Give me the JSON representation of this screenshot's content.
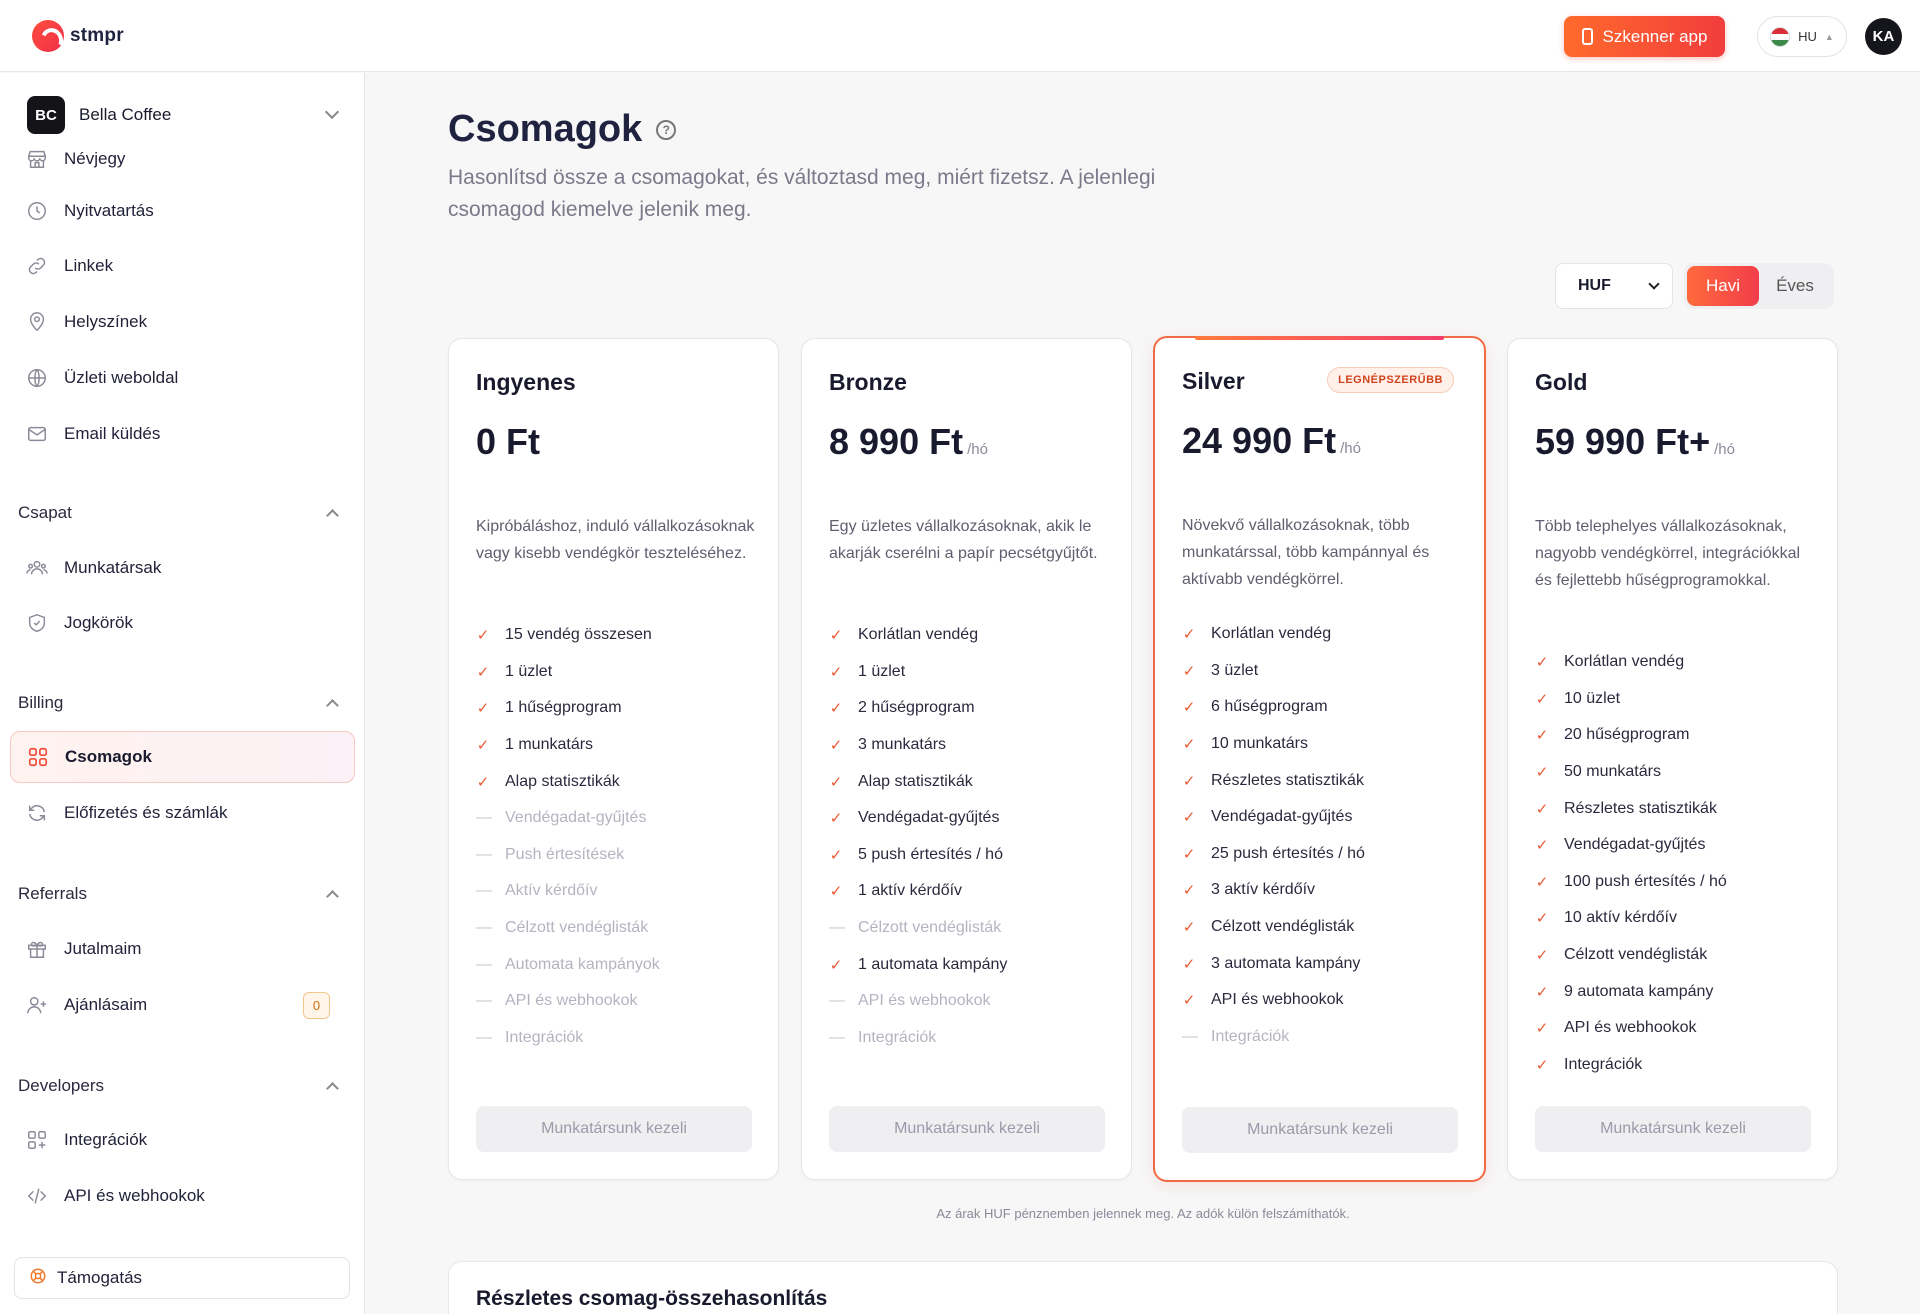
{
  "app": {
    "logo_text": "stmpr"
  },
  "topbar": {
    "scanner_label": "Szkenner app",
    "language": "HU",
    "user_initials": "KA"
  },
  "sidebar": {
    "business": {
      "initials": "BC",
      "name": "Bella Coffee"
    },
    "items_main": [
      {
        "label": "Névjegy",
        "icon": "store-icon"
      },
      {
        "label": "Nyitvatartás",
        "icon": "clock-icon"
      },
      {
        "label": "Linkek",
        "icon": "link-icon"
      },
      {
        "label": "Helyszínek",
        "icon": "location-pin-icon"
      },
      {
        "label": "Üzleti weboldal",
        "icon": "globe-icon"
      },
      {
        "label": "Email küldés",
        "icon": "mail-icon"
      }
    ],
    "sections": {
      "team": {
        "title": "Csapat",
        "items": [
          {
            "label": "Munkatársak",
            "icon": "users-icon"
          },
          {
            "label": "Jogkörök",
            "icon": "shield-icon"
          }
        ]
      },
      "billing": {
        "title": "Billing",
        "items": [
          {
            "label": "Csomagok",
            "icon": "grid-icon"
          },
          {
            "label": "Előfizetés és számlák",
            "icon": "refresh-icon"
          }
        ]
      },
      "referrals": {
        "title": "Referrals",
        "items": [
          {
            "label": "Jutalmaim",
            "icon": "gift-icon"
          },
          {
            "label": "Ajánlásaim",
            "icon": "user-plus-icon",
            "count": "0"
          }
        ]
      },
      "developers": {
        "title": "Developers",
        "items": [
          {
            "label": "Integrációk",
            "icon": "puzzle-icon"
          },
          {
            "label": "API és webhookok",
            "icon": "code-icon"
          }
        ]
      }
    },
    "support_label": "Támogatás"
  },
  "main": {
    "title": "Csomagok",
    "subtitle": "Hasonlítsd össze a csomagokat, és változtasd meg, miért fizetsz. A jelenlegi csomagod kiemelve jelenik meg.",
    "currency": "HUF",
    "period_options": [
      "Havi",
      "Éves"
    ],
    "period_selected": "Havi",
    "plans": [
      {
        "name": "Ingyenes",
        "price": "0 Ft",
        "per": "",
        "description": "Kipróbáláshoz, induló vállalkozásoknak vagy kisebb vendégkör teszteléséhez.",
        "features": [
          {
            "text": "15 vendég összesen",
            "included": true
          },
          {
            "text": "1 üzlet",
            "included": true
          },
          {
            "text": "1 hűségprogram",
            "included": true
          },
          {
            "text": "1 munkatárs",
            "included": true
          },
          {
            "text": "Alap statisztikák",
            "included": true
          },
          {
            "text": "Vendégadat-gyűjtés",
            "included": false
          },
          {
            "text": "Push értesítések",
            "included": false
          },
          {
            "text": "Aktív kérdőív",
            "included": false
          },
          {
            "text": "Célzott vendéglisták",
            "included": false
          },
          {
            "text": "Automata kampányok",
            "included": false
          },
          {
            "text": "API és webhookok",
            "included": false
          },
          {
            "text": "Integrációk",
            "included": false
          }
        ],
        "button": "Munkatársunk kezeli"
      },
      {
        "name": "Bronze",
        "price": "8 990 Ft",
        "per": "/hó",
        "description": "Egy üzletes vállalkozásoknak, akik le akarják cserélni a papír pecsétgyűjtőt.",
        "features": [
          {
            "text": "Korlátlan vendég",
            "included": true
          },
          {
            "text": "1 üzlet",
            "included": true
          },
          {
            "text": "2 hűségprogram",
            "included": true
          },
          {
            "text": "3 munkatárs",
            "included": true
          },
          {
            "text": "Alap statisztikák",
            "included": true
          },
          {
            "text": "Vendégadat-gyűjtés",
            "included": true
          },
          {
            "text": "5 push értesítés / hó",
            "included": true
          },
          {
            "text": "1 aktív kérdőív",
            "included": true
          },
          {
            "text": "Célzott vendéglisták",
            "included": false
          },
          {
            "text": "1 automata kampány",
            "included": true
          },
          {
            "text": "API és webhookok",
            "included": false
          },
          {
            "text": "Integrációk",
            "included": false
          }
        ],
        "button": "Munkatársunk kezeli"
      },
      {
        "name": "Silver",
        "price": "24 990 Ft",
        "per": "/hó",
        "badge": "LEGNÉPSZERŰBB",
        "description": "Növekvő vállalkozásoknak, több munkatárssal, több kampánnyal és aktívabb vendégkörrel.",
        "features": [
          {
            "text": "Korlátlan vendég",
            "included": true
          },
          {
            "text": "3 üzlet",
            "included": true
          },
          {
            "text": "6 hűségprogram",
            "included": true
          },
          {
            "text": "10 munkatárs",
            "included": true
          },
          {
            "text": "Részletes statisztikák",
            "included": true
          },
          {
            "text": "Vendégadat-gyűjtés",
            "included": true
          },
          {
            "text": "25 push értesítés / hó",
            "included": true
          },
          {
            "text": "3 aktív kérdőív",
            "included": true
          },
          {
            "text": "Célzott vendéglisták",
            "included": true
          },
          {
            "text": "3 automata kampány",
            "included": true
          },
          {
            "text": "API és webhookok",
            "included": true
          },
          {
            "text": "Integrációk",
            "included": false
          }
        ],
        "button": "Munkatársunk kezeli"
      },
      {
        "name": "Gold",
        "price": "59 990 Ft+",
        "per": "/hó",
        "description": "Több telephelyes vállalkozásoknak, nagyobb vendégkörrel, integrációkkal és fejlettebb hűségprogramokkal.",
        "features": [
          {
            "text": "Korlátlan vendég",
            "included": true
          },
          {
            "text": "10 üzlet",
            "included": true
          },
          {
            "text": "20 hűségprogram",
            "included": true
          },
          {
            "text": "50 munkatárs",
            "included": true
          },
          {
            "text": "Részletes statisztikák",
            "included": true
          },
          {
            "text": "Vendégadat-gyűjtés",
            "included": true
          },
          {
            "text": "100 push értesítés / hó",
            "included": true
          },
          {
            "text": "10 aktív kérdőív",
            "included": true
          },
          {
            "text": "Célzott vendéglisták",
            "included": true
          },
          {
            "text": "9 automata kampány",
            "included": true
          },
          {
            "text": "API és webhookok",
            "included": true
          },
          {
            "text": "Integrációk",
            "included": true
          }
        ],
        "button": "Munkatársunk kezeli"
      }
    ],
    "note": "Az árak HUF pénznemben jelennek meg. Az adók külön felszámíthatók.",
    "comparison_title": "Részletes csomag-összehasonlítás"
  },
  "colors": {
    "accent": "#f04b3a",
    "accent_gradient_start": "#ff6a2b",
    "accent_gradient_end": "#f23d3d"
  }
}
